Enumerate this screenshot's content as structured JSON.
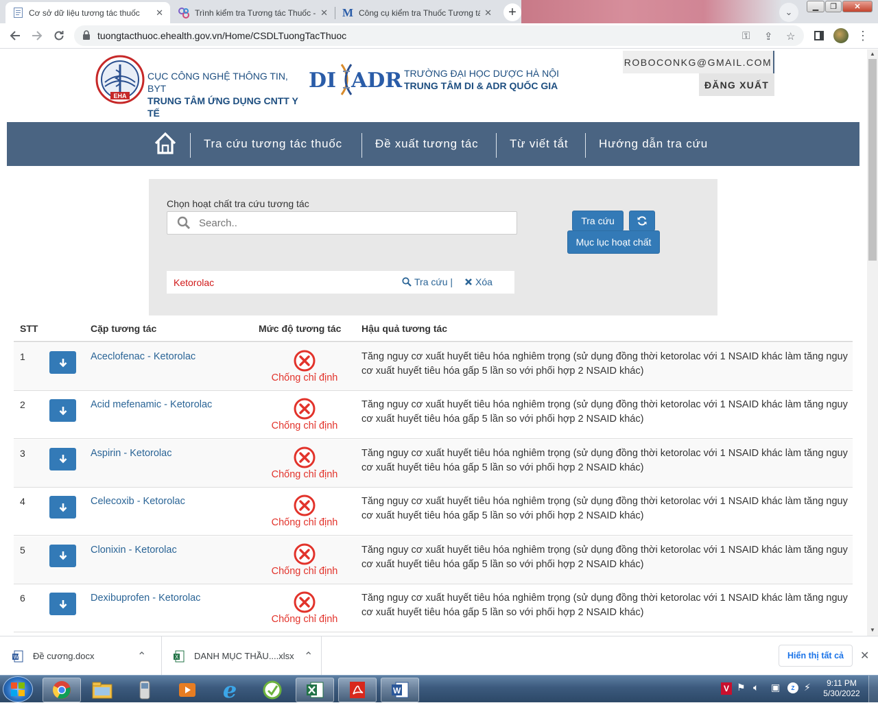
{
  "browser": {
    "tabs": [
      {
        "title": "Cơ sở dữ liệu tương tác thuốc",
        "active": true
      },
      {
        "title": "Trình kiểm tra Tương tác Thuốc - ",
        "active": false
      },
      {
        "title": "Công cụ kiểm tra Thuốc Tương tá",
        "active": false
      }
    ],
    "new_tab": "+",
    "url": "tuongtacthuoc.ehealth.gov.vn/Home/CSDLTuongTacThuoc"
  },
  "header": {
    "org1_line1": "CỤC CÔNG NGHỆ THÔNG TIN, BYT",
    "org1_line2": "TRUNG TÂM ỨNG DỤNG CNTT Y",
    "org1_line3": "TẾ",
    "logo_badge": "EHA",
    "org2_logo_left": "DI",
    "org2_logo_right": "ADR",
    "org2_line1": "TRƯỜNG ĐẠI HỌC DƯỢC HÀ NỘI",
    "org2_line2": "TRUNG TÂM DI & ADR QUỐC GIA",
    "user_email": "ROBOCONKG@GMAIL.COM",
    "logout": "ĐĂNG XUẤT"
  },
  "nav": {
    "items": [
      "Tra cứu tương tác thuốc",
      "Đề xuất tương tác",
      "Từ viết tắt",
      "Hướng dẫn tra cứu"
    ]
  },
  "search": {
    "label": "Chọn hoạt chất tra cứu tương tác",
    "placeholder": "Search..",
    "lookup_button": "Tra cứu",
    "index_button": "Mục lục hoạt chất",
    "selected_drug": "Ketorolac",
    "selected_lookup": "Tra cứu |",
    "selected_delete": "Xóa"
  },
  "table": {
    "headers": [
      "STT",
      "Cặp tương tác",
      "Mức độ tương tác",
      "Hậu quả tương tác"
    ],
    "rows": [
      {
        "stt": "1",
        "pair": "Aceclofenac - Ketorolac",
        "severity": "Chống chỉ định",
        "consequence": "Tăng nguy cơ xuất huyết tiêu hóa nghiêm trọng (sử dụng đồng thời ketorolac với 1 NSAID khác làm tăng nguy cơ xuất huyết tiêu hóa gấp 5 lần so với phối hợp 2 NSAID khác)"
      },
      {
        "stt": "2",
        "pair": "Acid mefenamic - Ketorolac",
        "severity": "Chống chỉ định",
        "consequence": "Tăng nguy cơ xuất huyết tiêu hóa nghiêm trọng (sử dụng đồng thời ketorolac với 1 NSAID khác làm tăng nguy cơ xuất huyết tiêu hóa gấp 5 lần so với phối hợp 2 NSAID khác)"
      },
      {
        "stt": "3",
        "pair": "Aspirin - Ketorolac",
        "severity": "Chống chỉ định",
        "consequence": "Tăng nguy cơ xuất huyết tiêu hóa nghiêm trọng (sử dụng đồng thời ketorolac với 1 NSAID khác làm tăng nguy cơ xuất huyết tiêu hóa gấp 5 lần so với phối hợp 2 NSAID khác)"
      },
      {
        "stt": "4",
        "pair": "Celecoxib - Ketorolac",
        "severity": "Chống chỉ định",
        "consequence": "Tăng nguy cơ xuất huyết tiêu hóa nghiêm trọng (sử dụng đồng thời ketorolac với 1 NSAID khác làm tăng nguy cơ xuất huyết tiêu hóa gấp 5 lần so với phối hợp 2 NSAID khác)"
      },
      {
        "stt": "5",
        "pair": "Clonixin - Ketorolac",
        "severity": "Chống chỉ định",
        "consequence": "Tăng nguy cơ xuất huyết tiêu hóa nghiêm trọng (sử dụng đồng thời ketorolac với 1 NSAID khác làm tăng nguy cơ xuất huyết tiêu hóa gấp 5 lần so với phối hợp 2 NSAID khác)"
      },
      {
        "stt": "6",
        "pair": "Dexibuprofen - Ketorolac",
        "severity": "Chống chỉ định",
        "consequence": "Tăng nguy cơ xuất huyết tiêu hóa nghiêm trọng (sử dụng đồng thời ketorolac với 1 NSAID khác làm tăng nguy cơ xuất huyết tiêu hóa gấp 5 lần so với phối hợp 2 NSAID khác)"
      }
    ]
  },
  "downloads": {
    "items": [
      "Đề cương.docx",
      "DANH MỤC THẦU....xlsx"
    ],
    "show_all": "Hiển thị tất cả"
  },
  "taskbar": {
    "time": "9:11 PM",
    "date": "5/30/2022"
  },
  "colors": {
    "nav_bg": "#4a6482",
    "primary_button": "#337ab7",
    "contraindicated": "#e2332b",
    "link": "#2a6496"
  }
}
